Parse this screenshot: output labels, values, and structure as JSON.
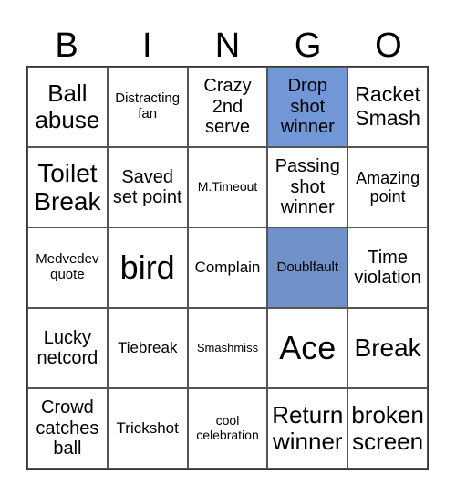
{
  "header": {
    "letters": [
      "B",
      "I",
      "N",
      "G",
      "O"
    ]
  },
  "colors": {
    "marked": "#7297d6",
    "marked_alt": "#7090c8",
    "grid_line": "#555555"
  },
  "cells": [
    {
      "text": "Ball abuse",
      "marked": false
    },
    {
      "text": "Distracting fan",
      "marked": false
    },
    {
      "text": "Crazy 2nd serve",
      "marked": false
    },
    {
      "text": "Drop shot winner",
      "marked": true
    },
    {
      "text": "Racket Smash",
      "marked": false
    },
    {
      "text": "Toilet Break",
      "marked": false
    },
    {
      "text": "Saved set point",
      "marked": false
    },
    {
      "text": "M.Timeout",
      "marked": false
    },
    {
      "text": "Passing shot winner",
      "marked": false
    },
    {
      "text": "Amazing point",
      "marked": false
    },
    {
      "text": "Medvedev quote",
      "marked": false
    },
    {
      "text": "bird",
      "marked": false
    },
    {
      "text": "Complain",
      "marked": false
    },
    {
      "text": "Doublfault",
      "marked": true
    },
    {
      "text": "Time violation",
      "marked": false
    },
    {
      "text": "Lucky netcord",
      "marked": false
    },
    {
      "text": "Tiebreak",
      "marked": false
    },
    {
      "text": "Smashmiss",
      "marked": false
    },
    {
      "text": "Ace",
      "marked": false
    },
    {
      "text": "Break",
      "marked": false
    },
    {
      "text": "Crowd catches ball",
      "marked": false
    },
    {
      "text": "Trickshot",
      "marked": false
    },
    {
      "text": "cool celebration",
      "marked": false
    },
    {
      "text": "Return winner",
      "marked": false
    },
    {
      "text": "broken screen",
      "marked": false
    }
  ]
}
